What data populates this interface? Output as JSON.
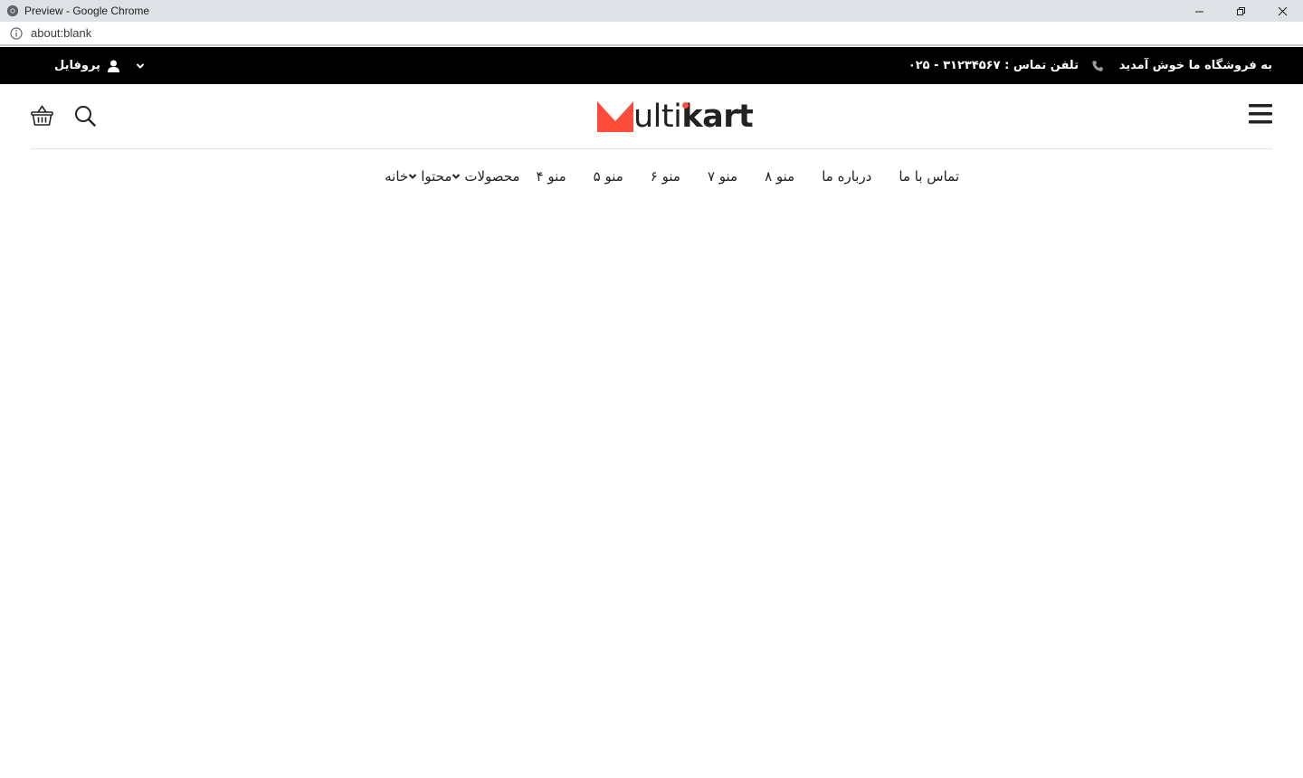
{
  "browser": {
    "window_title": "Preview - Google Chrome",
    "url": "about:blank"
  },
  "topbar": {
    "welcome": "به فروشگاه ما خوش آمدید",
    "phone": "تلفن تماس : ۳۱۲۳۴۵۶۷ - ۰۲۵",
    "profile_label": "پروفایل"
  },
  "logo": {
    "text_light": "ult",
    "text_i": "i",
    "text_bold": "kart",
    "accent_color": "#ff4c3b"
  },
  "nav": {
    "items": [
      {
        "label": "خانه",
        "dropdown": false
      },
      {
        "label": "محتوا",
        "dropdown": true
      },
      {
        "label": "محصولات",
        "dropdown": true
      },
      {
        "label": "منو ۴",
        "dropdown": false
      },
      {
        "label": "منو ۵",
        "dropdown": false
      },
      {
        "label": "منو ۶",
        "dropdown": false
      },
      {
        "label": "منو ۷",
        "dropdown": false
      },
      {
        "label": "منو ۸",
        "dropdown": false
      },
      {
        "label": "درباره ما",
        "dropdown": false
      },
      {
        "label": "تماس با ما",
        "dropdown": false
      }
    ]
  },
  "icons": {
    "menu": "hamburger-icon",
    "search": "search-icon",
    "cart": "basket-icon",
    "phone": "phone-icon",
    "user": "user-icon"
  }
}
